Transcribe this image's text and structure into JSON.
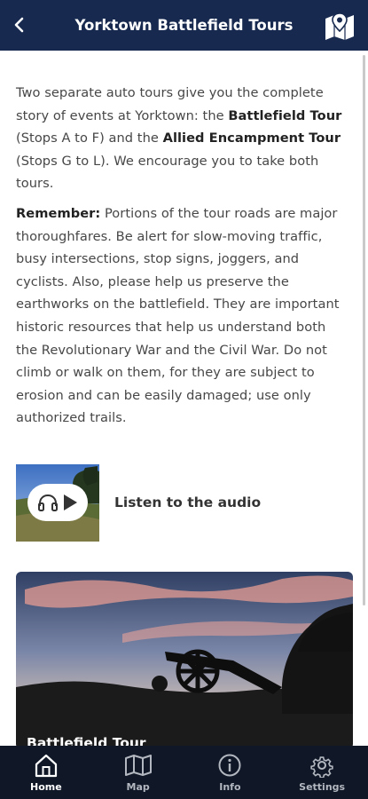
{
  "header": {
    "title": "Yorktown Battlefield Tours"
  },
  "intro": {
    "part1": "Two separate auto tours give you the complete story of events at Yorktown: the ",
    "bold1": "Battlefield Tour",
    "part2": " (Stops A to F) and the ",
    "bold2": "Allied Encampment Tour",
    "part3": " (Stops G to L). We encourage you to take both tours."
  },
  "remember": {
    "label": "Remember:",
    "text": " Portions of the tour roads are major thoroughfares. Be alert for slow-moving traffic, busy intersections, stop signs, joggers, and cyclists. Also, please help us preserve the earthworks on the battlefield. They are important historic resources that help us understand both the Revolutionary War and the Civil War. Do not climb or walk on them, for they are subject to erosion and can be easily damaged; use only authorized trails."
  },
  "audio": {
    "label": "Listen to the audio"
  },
  "card": {
    "title": "Battlefield Tour"
  },
  "nav": {
    "items": [
      {
        "label": "Home",
        "icon": "home-icon",
        "active": true
      },
      {
        "label": "Map",
        "icon": "map-icon",
        "active": false
      },
      {
        "label": "Info",
        "icon": "info-icon",
        "active": false
      },
      {
        "label": "Settings",
        "icon": "gear-icon",
        "active": false
      }
    ]
  },
  "colors": {
    "header_bg": "#17294f",
    "nav_bg": "#101828"
  }
}
